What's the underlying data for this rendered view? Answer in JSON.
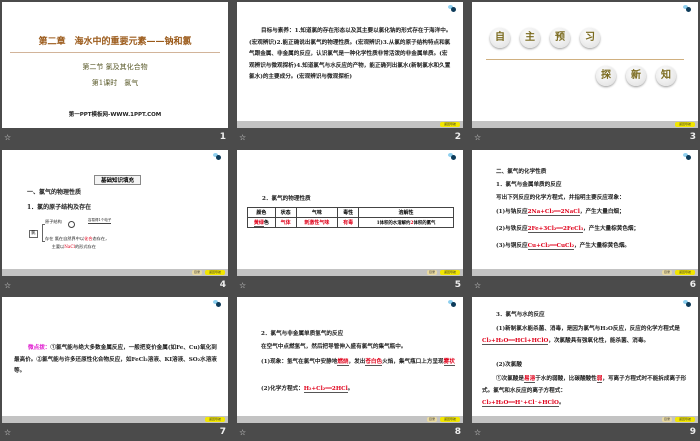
{
  "slides": [
    {
      "number": "1",
      "title": "第二章　海水中的重要元素——钠和氯",
      "section": "第二节 氯及其化合物",
      "lesson": "第1课时　氯气",
      "site": "第一PPT模板网-WWW.1PPT.COM"
    },
    {
      "number": "2",
      "text": "目标与素养：1.知道氯的存在形态以及其主要以氯化钠的形式存在于海洋中。(宏观辨识)2.能正确说出氯气的物理性质。(宏观辨识)3.从氯的原子结构特点和氯气跟金属、非金属的反应，认识氯气是一种化学性质非常活泼的非金属单质。(宏观辨识与微观探析)4.知道氯气与水反应的产物，能正确列出氯水(新制氯水和久置氯水)的主要成分。(宏观辨识与微观探析)"
    },
    {
      "number": "3",
      "row1": [
        "自",
        "主",
        "预",
        "习"
      ],
      "row2": [
        "探",
        "新",
        "知"
      ]
    },
    {
      "number": "4",
      "heading": "基础知识填充",
      "h1": "一、氯气的物理性质",
      "h2": "1．氯的原子结构及存在",
      "cl": "氯",
      "struct": "原子结构",
      "arrow": "容易得1个电子",
      "exist": "存在",
      "exist_text": "氯在自然界中以",
      "combined": "化合",
      "exist_text2": "态存在，",
      "main": "主要以",
      "nacl": "NaCl",
      "main2": "的形式存在"
    },
    {
      "number": "5",
      "heading": "2．氯气的物理性质",
      "headers": [
        "颜色",
        "状态",
        "气味",
        "毒性",
        "溶解性"
      ],
      "row": [
        "黄绿",
        "色",
        "气体",
        "刺激性气味",
        "有毒",
        "1体积的水溶解约",
        "2",
        "体积的氯气"
      ]
    },
    {
      "number": "6",
      "h1": "二、氯气的化学性质",
      "h2": "1．氯气与金属单质的反应",
      "intro": "写出下列反应的化学方程式，并指明主要反应现象：",
      "items": [
        {
          "label": "(1)与钠反应",
          "eq": "2Na+Cl₂══2NaCl",
          "cond": "点燃",
          "note": "，产生大量白烟；"
        },
        {
          "label": "(2)与铁反应",
          "eq": "2Fe+3Cl₂══2FeCl₃",
          "cond": "点燃",
          "note": "，产生大量棕黄色烟；"
        },
        {
          "label": "(3)与铜反应",
          "eq": "Cu+Cl₂══CuCl₂",
          "cond": "点燃",
          "note": "，产生大量棕黄色烟。"
        }
      ]
    },
    {
      "number": "7",
      "tip": "微点拨：",
      "text": "①氯气能与绝大多数金属反应，一般把变价金属(如Fe、Cu)氧化到最高价。②氯气能与许多还原性化合物反应，如FeCl₂溶液、KI溶液、SO₂水溶液等。"
    },
    {
      "number": "8",
      "h": "2．氯气与非金属单质氢气的反应",
      "p1": "在空气中点燃氢气，然后把导管伸入盛有氯气的集气瓶中。",
      "p2a": "(1)现象：氢气在氯气中安静地",
      "b1": "燃烧",
      "p2b": "，发出",
      "b2": "苍白色",
      "p2c": "火焰，集气瓶口上方呈现",
      "b3": "雾状",
      "p3": "(2)化学方程式：",
      "eq": "H₂+Cl₂══2HCl",
      "cond": "点燃"
    },
    {
      "number": "9",
      "h": "3．氯气与水的反应",
      "p1": "(1)新制氯水能杀菌、消毒，是因为氯气与H₂O反应，反应的化学方程式是",
      "eq1": "Cl₂+H₂O══HCl+HClO",
      "p1b": "，次氯酸具有强氧化性，能杀菌、消毒。",
      "p2": "(2)次氯酸",
      "p3a": "①次氯酸是",
      "b1": "易溶",
      "p3b": "于水的弱酸，比碳酸酸性",
      "b2": "弱",
      "p3c": "，写离子方程式时不能拆成离子形式。氯气和水反应的离子方程式：",
      "eq2": "Cl₂+H₂O══H⁺+Cl⁻+HClO"
    }
  ],
  "footer_buttons": {
    "back": "目录",
    "home": "返回导航"
  },
  "colors": {
    "title_brown": "#9b5a1a",
    "red": "#e0001a",
    "bg": "#4b4b4b"
  }
}
